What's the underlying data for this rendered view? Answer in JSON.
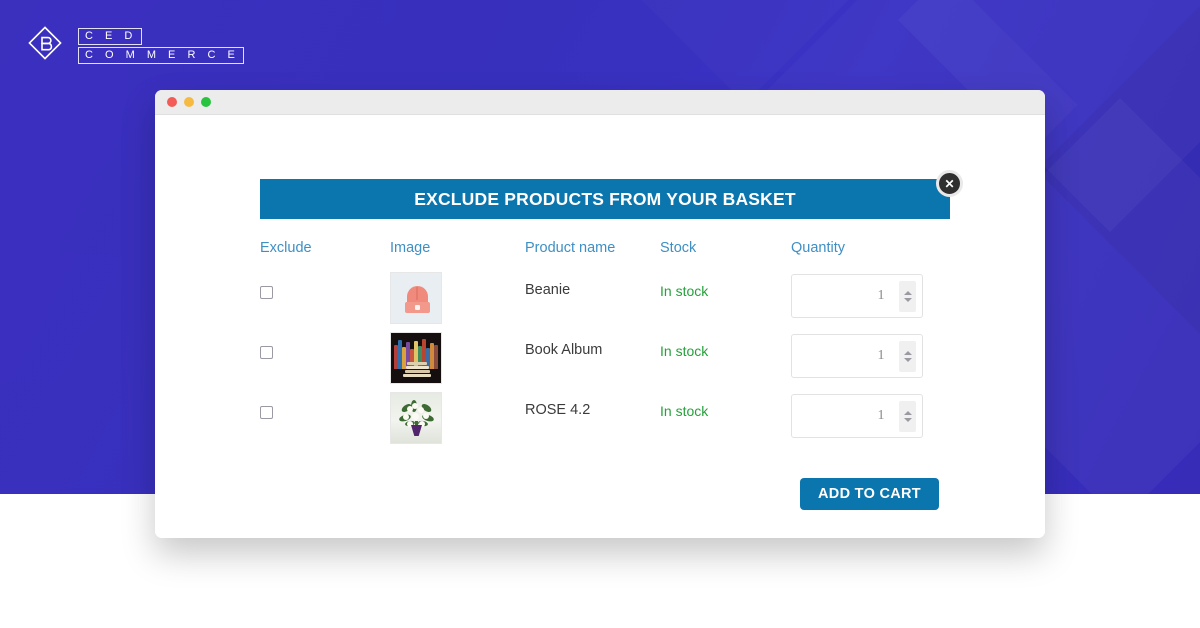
{
  "brand": {
    "logo_line1": "C E D",
    "logo_line2": "C O M M E R C E",
    "logo_icon": "ced-diamond-logo-icon"
  },
  "browser": {
    "traffic_lights": [
      "close-dot",
      "minimize-dot",
      "maximize-dot"
    ]
  },
  "modal": {
    "title": "EXCLUDE PRODUCTS FROM YOUR BASKET",
    "close_label": "✕",
    "accent_color": "#0b75ad",
    "header_text_color": "#ffffff"
  },
  "table": {
    "headers": {
      "exclude": "Exclude",
      "image": "Image",
      "product_name": "Product name",
      "stock": "Stock",
      "quantity": "Quantity"
    },
    "header_color": "#3f8fc4",
    "stock_color": "#27a03c",
    "rows": [
      {
        "checked": false,
        "image_alt": "beanie-hat-thumbnail",
        "name": "Beanie",
        "stock": "In stock",
        "quantity": "1"
      },
      {
        "checked": false,
        "image_alt": "book-album-thumbnail",
        "name": "Book Album",
        "stock": "In stock",
        "quantity": "1"
      },
      {
        "checked": false,
        "image_alt": "rose-bouquet-thumbnail",
        "name": "ROSE 4.2",
        "stock": "In stock",
        "quantity": "1"
      }
    ]
  },
  "actions": {
    "add_to_cart": "ADD TO CART"
  }
}
